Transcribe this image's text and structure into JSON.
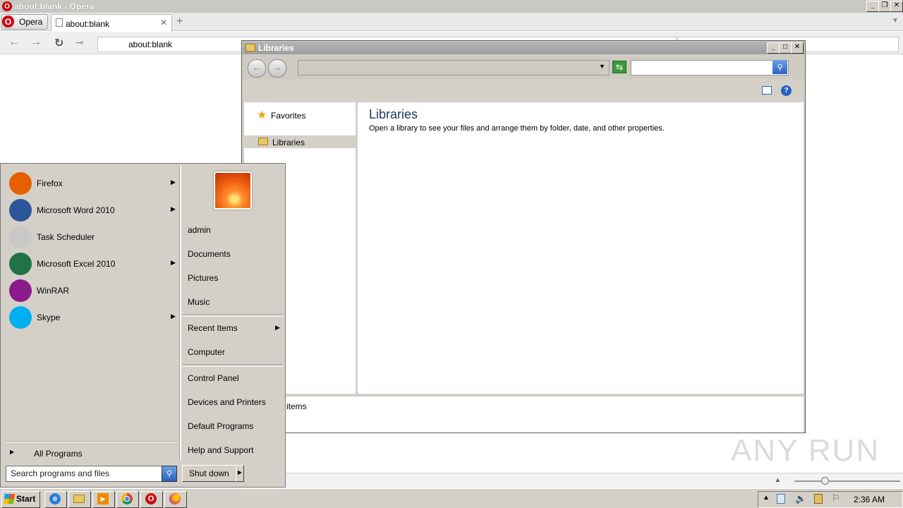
{
  "opera": {
    "window_title": "about:blank - Opera",
    "menu_label": "Opera",
    "tab_label": "about:blank",
    "address_value": "about:blank"
  },
  "explorer": {
    "title": "Libraries",
    "nav": {
      "favorites": "Favorites",
      "libraries": "Libraries"
    },
    "heading": "Libraries",
    "description": "Open a library to see your files and arrange them by folder, date, and other properties.",
    "status": "0 items"
  },
  "start_menu": {
    "programs": [
      {
        "label": "Firefox",
        "icon": "firefox-icon",
        "arrow": true,
        "color": "#e66000"
      },
      {
        "label": "Microsoft Word 2010",
        "icon": "word-icon",
        "arrow": true,
        "color": "#2b579a"
      },
      {
        "label": "Task Scheduler",
        "icon": "clock-icon",
        "arrow": false,
        "color": "#c8c8c8"
      },
      {
        "label": "Microsoft Excel 2010",
        "icon": "excel-icon",
        "arrow": true,
        "color": "#217346"
      },
      {
        "label": "WinRAR",
        "icon": "winrar-icon",
        "arrow": false,
        "color": "#8b1a8b"
      },
      {
        "label": "Skype",
        "icon": "skype-icon",
        "arrow": true,
        "color": "#00aff0"
      }
    ],
    "all_programs": "All Programs",
    "search_placeholder": "Search programs and files",
    "right_links": {
      "user": "admin",
      "documents": "Documents",
      "pictures": "Pictures",
      "music": "Music",
      "recent_items": "Recent Items",
      "computer": "Computer",
      "control_panel": "Control Panel",
      "devices_printers": "Devices and Printers",
      "default_programs": "Default Programs",
      "help_support": "Help and Support"
    },
    "shutdown_label": "Shut down"
  },
  "taskbar": {
    "start_label": "Start",
    "clock": "2:36 AM"
  },
  "watermark": "ANY RUN"
}
